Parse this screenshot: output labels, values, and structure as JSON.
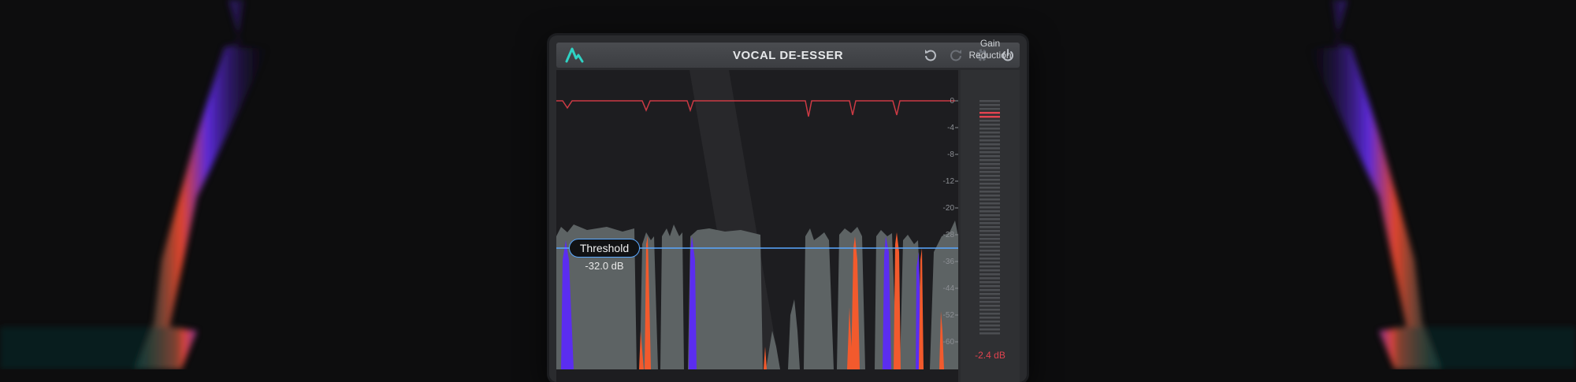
{
  "app": {
    "title": "VOCAL DE-ESSER",
    "accent_color": "#2fd3c4",
    "threshold_color": "#5aa8ff",
    "reduction_color": "#e0434f"
  },
  "toolbar": {
    "undo_icon": "undo-icon",
    "redo_icon": "redo-icon",
    "settings_icon": "gear-icon",
    "power_icon": "power-icon"
  },
  "graph": {
    "db_scale": [
      "0",
      "-4",
      "-8",
      "-12",
      "-20",
      "-28",
      "-36",
      "-44",
      "-52",
      "-60"
    ],
    "threshold": {
      "label": "Threshold",
      "value": "-32.0 dB"
    }
  },
  "meter": {
    "label_line1": "Gain",
    "label_line2": "Reduction",
    "value": "-2.4 dB"
  }
}
